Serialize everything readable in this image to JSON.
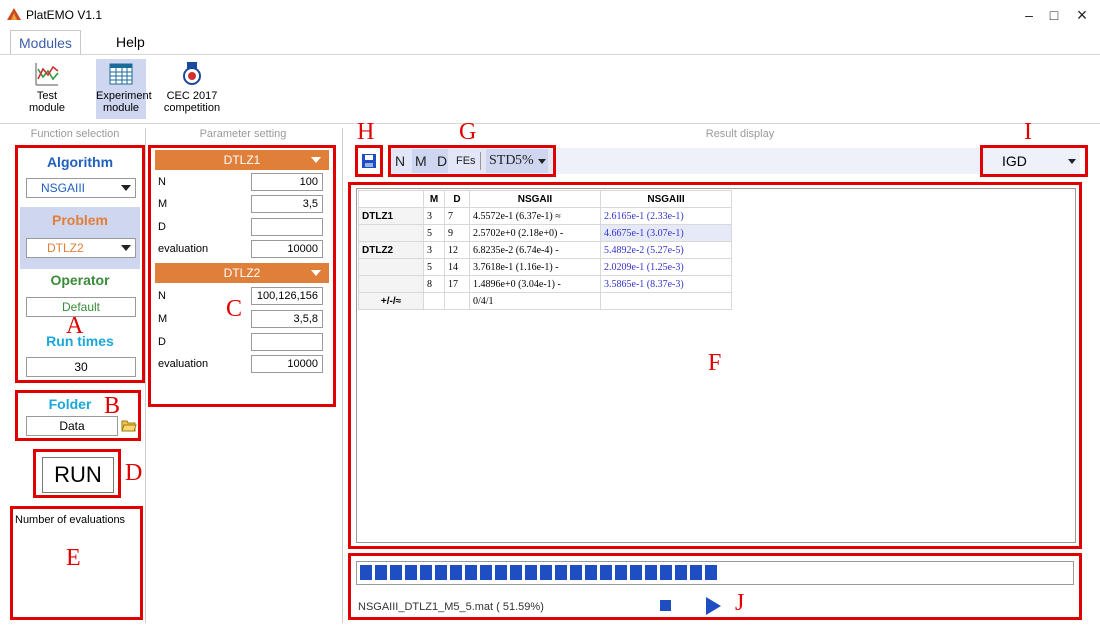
{
  "window": {
    "title": "PlatEMO V1.1",
    "minimize": "–",
    "maximize": "□",
    "close": "×"
  },
  "menu": {
    "tabs": [
      "Modules",
      "Help"
    ]
  },
  "ribbon": {
    "buttons": [
      {
        "label1": "Test",
        "label2": "module",
        "icon": "pareto-chart-icon"
      },
      {
        "label1": "Experiment",
        "label2": "module",
        "icon": "table-grid-icon"
      },
      {
        "label1": "CEC 2017",
        "label2": "competition",
        "icon": "medal-icon"
      }
    ]
  },
  "panels": {
    "function_selection": "Function selection",
    "parameter_setting": "Parameter setting",
    "result_display": "Result display"
  },
  "function": {
    "algorithm_title": "Algorithm",
    "algorithm_value": "NSGAIII",
    "problem_title": "Problem",
    "problem_value": "DTLZ2",
    "operator_title": "Operator",
    "operator_value": "Default",
    "runtimes_title": "Run times",
    "runtimes_value": "30",
    "folder_title": "Folder",
    "folder_value": "Data",
    "run_label": "RUN",
    "evaluations_label": "Number of evaluations"
  },
  "params": [
    {
      "problem": "DTLZ1",
      "rows": [
        {
          "k": "N",
          "v": "100"
        },
        {
          "k": "M",
          "v": "3,5"
        },
        {
          "k": "D",
          "v": ""
        },
        {
          "k": "evaluation",
          "v": "10000"
        }
      ]
    },
    {
      "problem": "DTLZ2",
      "rows": [
        {
          "k": "N",
          "v": "100,126,156"
        },
        {
          "k": "M",
          "v": "3,5,8"
        },
        {
          "k": "D",
          "v": ""
        },
        {
          "k": "evaluation",
          "v": "10000"
        }
      ]
    }
  ],
  "toolbar": {
    "items": [
      "N",
      "M",
      "D",
      "FEs",
      "STD",
      "5%"
    ],
    "metric": "IGD"
  },
  "table": {
    "headers": [
      "",
      "M",
      "D",
      "NSGAII",
      "NSGAIII"
    ],
    "rows": [
      {
        "problem": "DTLZ1",
        "m": "3",
        "d": "7",
        "a": "4.5572e-1 (6.37e-1) ≈",
        "b": "2.6165e-1 (2.33e-1)"
      },
      {
        "problem": "",
        "m": "5",
        "d": "9",
        "a": "2.5702e+0 (2.18e+0) -",
        "b": "4.6675e-1 (3.07e-1)"
      },
      {
        "problem": "DTLZ2",
        "m": "3",
        "d": "12",
        "a": "6.8235e-2 (6.74e-4) -",
        "b": "5.4892e-2 (5.27e-5)"
      },
      {
        "problem": "",
        "m": "5",
        "d": "14",
        "a": "3.7618e-1 (1.16e-1) -",
        "b": "2.0209e-1 (1.25e-3)"
      },
      {
        "problem": "",
        "m": "8",
        "d": "17",
        "a": "1.4896e+0 (3.04e-1) -",
        "b": "3.5865e-1 (8.37e-3)"
      },
      {
        "problem": "+/-/≈",
        "m": "",
        "d": "",
        "a": "0/4/1",
        "b": ""
      }
    ]
  },
  "status": {
    "file": "NSGAIII_DTLZ1_M5_5.mat ( 51.59%)",
    "progress": 0.5159
  },
  "annotations": {
    "A": "A",
    "B": "B",
    "C": "C",
    "D": "D",
    "E": "E",
    "F": "F",
    "G": "G",
    "H": "H",
    "I": "I",
    "J": "J"
  },
  "colors": {
    "accent_blue": "#2060c0",
    "problem_orange": "#e07f3a",
    "operator_green": "#3a8a3a",
    "runtimes_cyan": "#1aa8d8",
    "annotation_red": "#e10000",
    "progress_blue": "#1f4ec2"
  }
}
